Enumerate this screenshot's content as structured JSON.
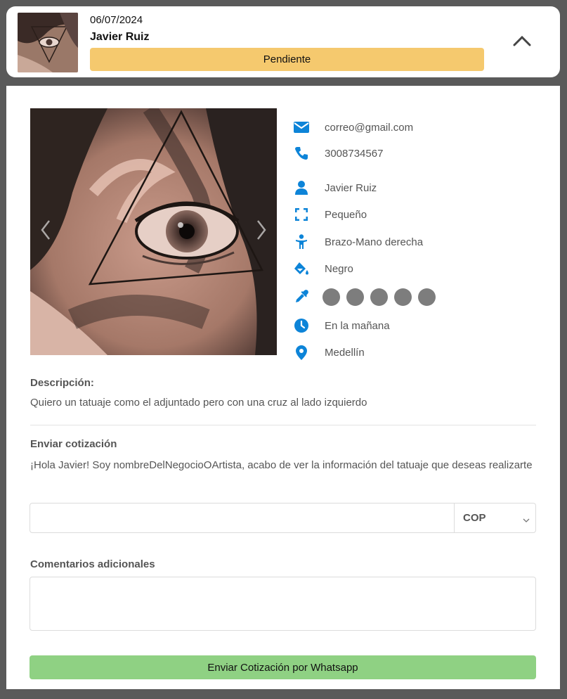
{
  "header": {
    "date": "06/07/2024",
    "name": "Javier Ruiz",
    "status": "Pendiente",
    "status_color": "#f5c96e"
  },
  "request": {
    "email": "correo@gmail.com",
    "phone": "3008734567",
    "client_name": "Javier Ruiz",
    "size": "Pequeño",
    "body_part": "Brazo-Mano derecha",
    "color": "Negro",
    "color_swatches": [
      "#7d7d7d",
      "#7d7d7d",
      "#7d7d7d",
      "#7d7d7d",
      "#7d7d7d"
    ],
    "schedule": "En la mañana",
    "city": "Medellín"
  },
  "icons": {
    "email": "envelope-icon",
    "phone": "phone-icon",
    "user": "user-icon",
    "size": "expand-icon",
    "body_part": "child-icon",
    "color": "paint-bucket-icon",
    "palette": "eyedropper-icon",
    "schedule": "clock-icon",
    "city": "map-pin-icon",
    "collapse": "chevron-up-icon"
  },
  "description": {
    "label": "Descripción:",
    "text": "Quiero un tatuaje como el adjuntado pero con una cruz al lado izquierdo"
  },
  "quote": {
    "label": "Enviar cotización",
    "message": "¡Hola Javier! Soy nombreDelNegocioOArtista, acabo de ver la información del tatuaje que deseas realizarte",
    "price_value": "",
    "currency": "COP"
  },
  "comments": {
    "label": "Comentarios adicionales",
    "value": ""
  },
  "actions": {
    "send_label": "Enviar Cotización por Whatsapp"
  },
  "colors": {
    "accent_icon": "#0d84d8",
    "send_button": "#8fd183"
  }
}
